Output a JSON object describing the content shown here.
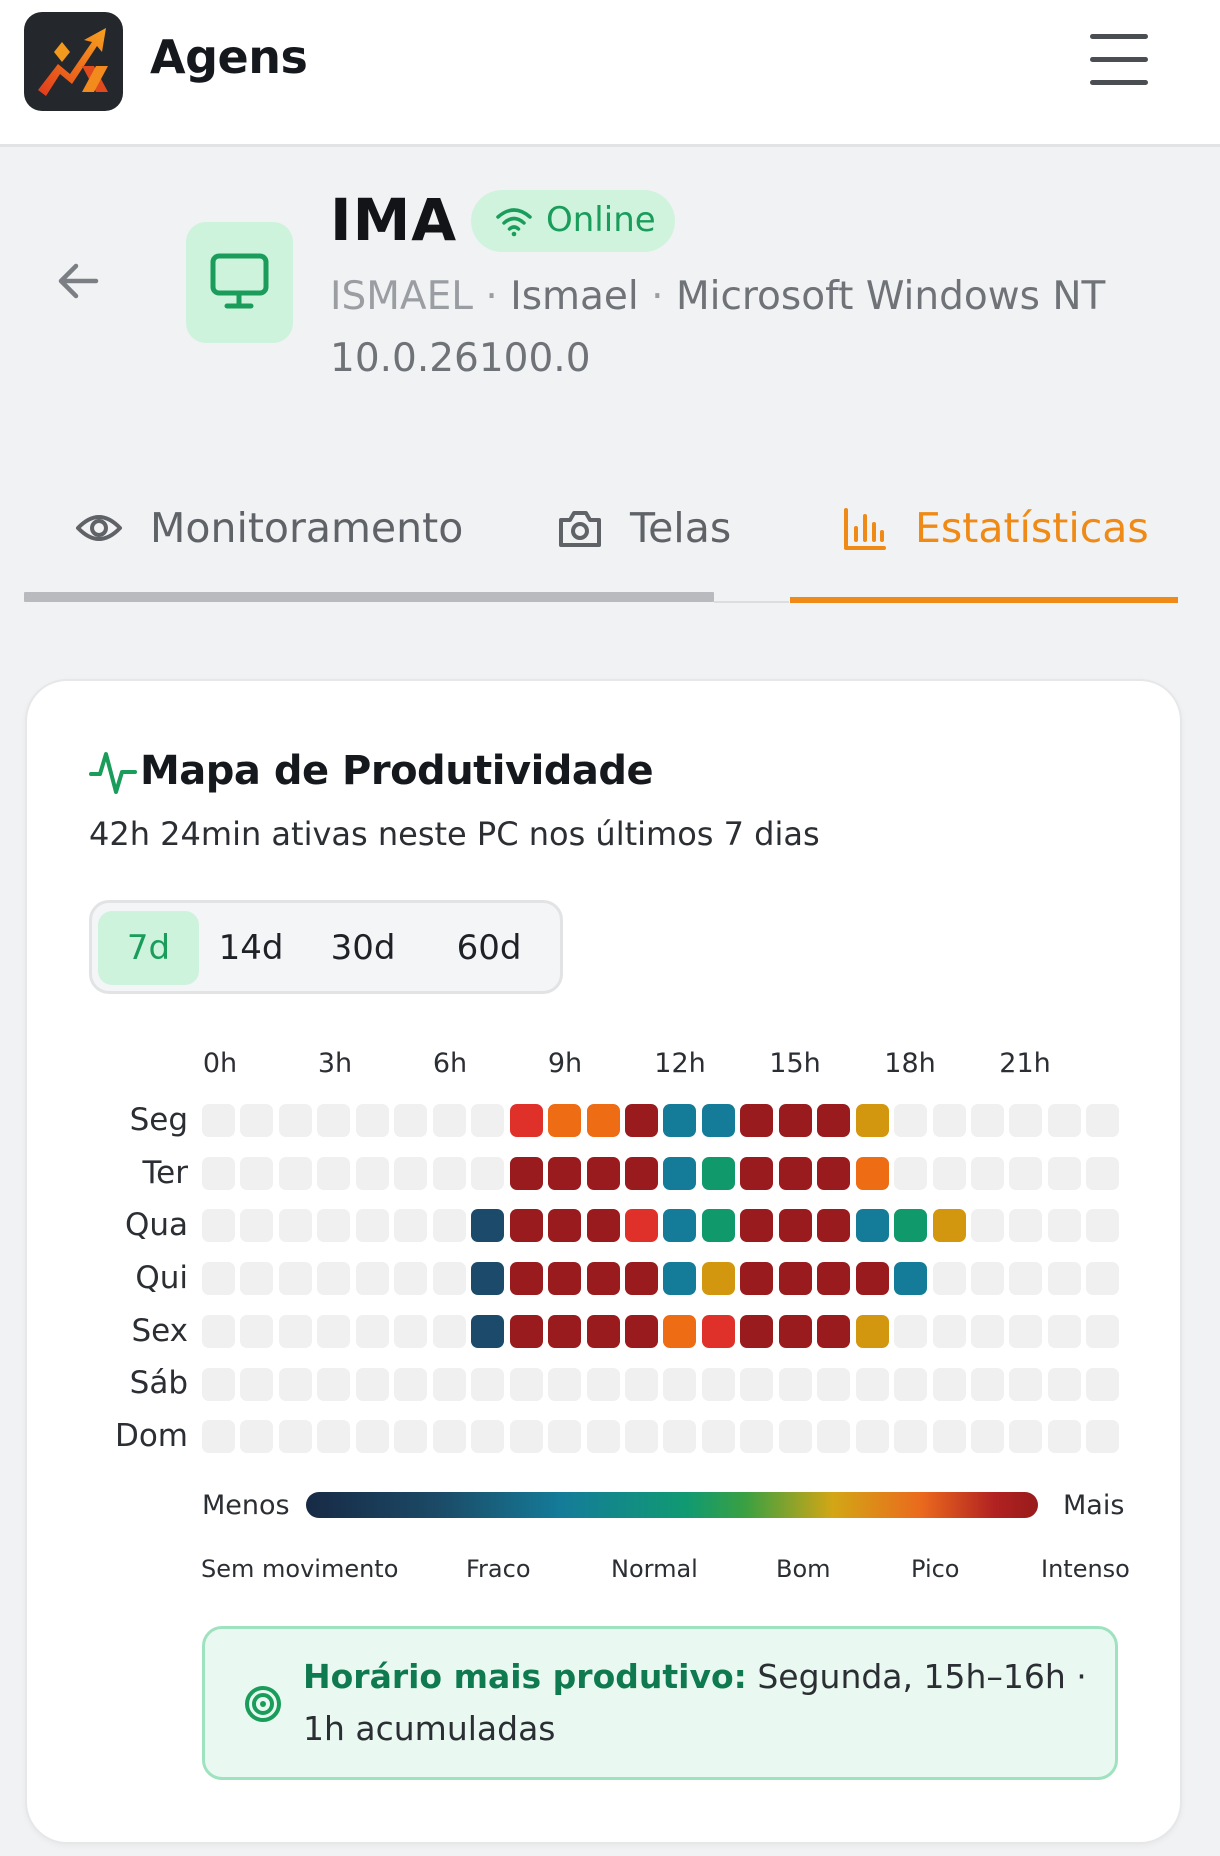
{
  "app": {
    "name": "Agens"
  },
  "device": {
    "title": "IMA",
    "status": "Online",
    "host": "ISMAEL",
    "user": "Ismael",
    "os_line1": "Microsoft Windows NT",
    "os_line2": "10.0.26100.0",
    "separator": "·"
  },
  "tabs": [
    {
      "label": "Monitoramento",
      "icon": "eye-icon",
      "active": false
    },
    {
      "label": "Telas",
      "icon": "camera-icon",
      "active": false
    },
    {
      "label": "Estatísticas",
      "icon": "bar-chart-icon",
      "active": true
    }
  ],
  "card": {
    "title": "Mapa de Produtividade",
    "subtitle": "42h 24min ativas neste PC nos últimos 7 dias",
    "ranges": [
      {
        "label": "7d",
        "active": true
      },
      {
        "label": "14d",
        "active": false
      },
      {
        "label": "30d",
        "active": false
      },
      {
        "label": "60d",
        "active": false
      }
    ]
  },
  "heatmap": {
    "hour_labels": [
      "0h",
      "3h",
      "6h",
      "9h",
      "12h",
      "15h",
      "18h",
      "21h"
    ],
    "days": [
      "Seg",
      "Ter",
      "Qua",
      "Qui",
      "Sex",
      "Sáb",
      "Dom"
    ],
    "levels_by_day": [
      [
        0,
        0,
        0,
        0,
        0,
        0,
        0,
        0,
        8,
        7,
        7,
        9,
        4,
        4,
        9,
        9,
        9,
        6,
        0,
        0,
        0,
        0,
        0,
        0
      ],
      [
        0,
        0,
        0,
        0,
        0,
        0,
        0,
        0,
        9,
        9,
        9,
        9,
        4,
        5,
        9,
        9,
        9,
        7,
        0,
        0,
        0,
        0,
        0,
        0
      ],
      [
        0,
        0,
        0,
        0,
        0,
        0,
        0,
        3,
        9,
        9,
        9,
        8,
        4,
        5,
        9,
        9,
        9,
        4,
        5,
        6,
        0,
        0,
        0,
        0
      ],
      [
        0,
        0,
        0,
        0,
        0,
        0,
        0,
        3,
        9,
        9,
        9,
        9,
        4,
        6,
        9,
        9,
        9,
        9,
        4,
        0,
        0,
        0,
        0,
        0
      ],
      [
        0,
        0,
        0,
        0,
        0,
        0,
        0,
        3,
        9,
        9,
        9,
        9,
        7,
        8,
        9,
        9,
        9,
        6,
        0,
        0,
        0,
        0,
        0,
        0
      ],
      [
        0,
        0,
        0,
        0,
        0,
        0,
        0,
        0,
        0,
        0,
        0,
        0,
        0,
        0,
        0,
        0,
        0,
        0,
        0,
        0,
        0,
        0,
        0,
        0
      ],
      [
        0,
        0,
        0,
        0,
        0,
        0,
        0,
        0,
        0,
        0,
        0,
        0,
        0,
        0,
        0,
        0,
        0,
        0,
        0,
        0,
        0,
        0,
        0,
        0
      ]
    ],
    "level_colors": [
      "#f0f0f1",
      "#172a45",
      "#1b4a66",
      "#1b4a6b",
      "#147c99",
      "#10996b",
      "#d3960f",
      "#ee6c14",
      "#e0302a",
      "#991b1e"
    ],
    "legend": {
      "less": "Menos",
      "more": "Mais",
      "words": [
        "Sem movimento",
        "Fraco",
        "Normal",
        "Bom",
        "Pico",
        "Intenso"
      ]
    }
  },
  "insight": {
    "label": "Horário mais produtivo:",
    "text": "Segunda, 15h–16h · 1h acumuladas"
  }
}
